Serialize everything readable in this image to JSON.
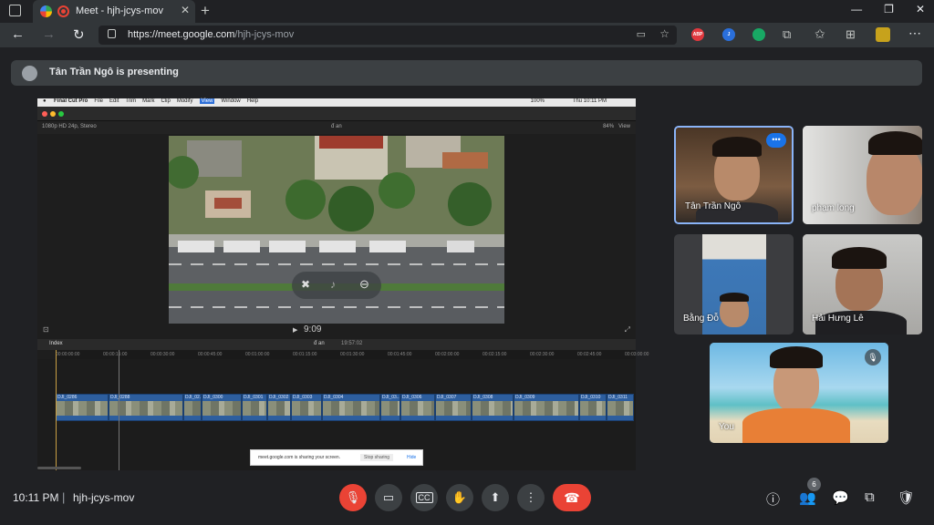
{
  "browser": {
    "tab_title": "Meet - hjh-jcys-mov",
    "tab_close": "✕",
    "new_tab": "+",
    "url_host": "https://meet.google.com",
    "url_path": "/hjh-jcys-mov",
    "window_controls": [
      "—",
      "❐",
      "✕"
    ],
    "extensions": [
      {
        "name": "adblock-plus-icon",
        "color": "#e0383e",
        "text": "ABP"
      },
      {
        "name": "j-extension-icon",
        "color": "#2a6fdb",
        "text": "J"
      },
      {
        "name": "shield-extension-icon",
        "color": "#18a864",
        "text": ""
      }
    ]
  },
  "meet": {
    "banner_text": "Tân Trần Ngô is presenting",
    "shared_screen": {
      "app_name": "Final Cut Pro",
      "menu": [
        "File",
        "Edit",
        "Trim",
        "Mark",
        "Clip",
        "Modify",
        "View",
        "Window",
        "Help"
      ],
      "menu_selected": "View",
      "clock": "Thu 10:11 PM",
      "battery": "100%",
      "viewer_info": "1080p HD 24p, Stereo",
      "viewer_clip": "đ an",
      "viewer_zoom": "84%",
      "viewer_view": "View",
      "timecode": "9:09",
      "timeline_index": "Index",
      "timeline_project": "đ an",
      "timeline_duration": "19:57:02",
      "ruler_marks": [
        "00:00:00:00",
        "00:00:15:00",
        "00:00:30:00",
        "00:00:45:00",
        "00:01:00:00",
        "00:01:15:00",
        "00:01:30:00",
        "00:01:45:00",
        "00:02:00:00",
        "00:02:15:00",
        "00:02:30:00",
        "00:02:45:00",
        "00:03:00:00"
      ],
      "clips": [
        "DJI_0286",
        "DJI_0288",
        "DJI_02..",
        "DJI_0300",
        "DJI_0301",
        "DJI_0302",
        "DJI_0303",
        "DJI_0304",
        "DJI_03..",
        "DJI_0306",
        "DJI_0307",
        "DJI_0308",
        "DJI_0309",
        "DJI_0310",
        "DJI_0311"
      ],
      "share_bar": {
        "message": "meet.google.com is sharing your screen.",
        "stop": "Stop sharing",
        "hide": "Hide"
      }
    },
    "participants": [
      {
        "name": "Tân Trần Ngô",
        "more": "•••"
      },
      {
        "name": "phạm long"
      },
      {
        "name": "Bằng Đỗ"
      },
      {
        "name": "Hải Hưng Lê"
      },
      {
        "name": "You"
      }
    ],
    "bottom": {
      "time": "10:11 PM",
      "separator": "|",
      "meeting_code": "hjh-jcys-mov",
      "people_count": "6"
    }
  }
}
